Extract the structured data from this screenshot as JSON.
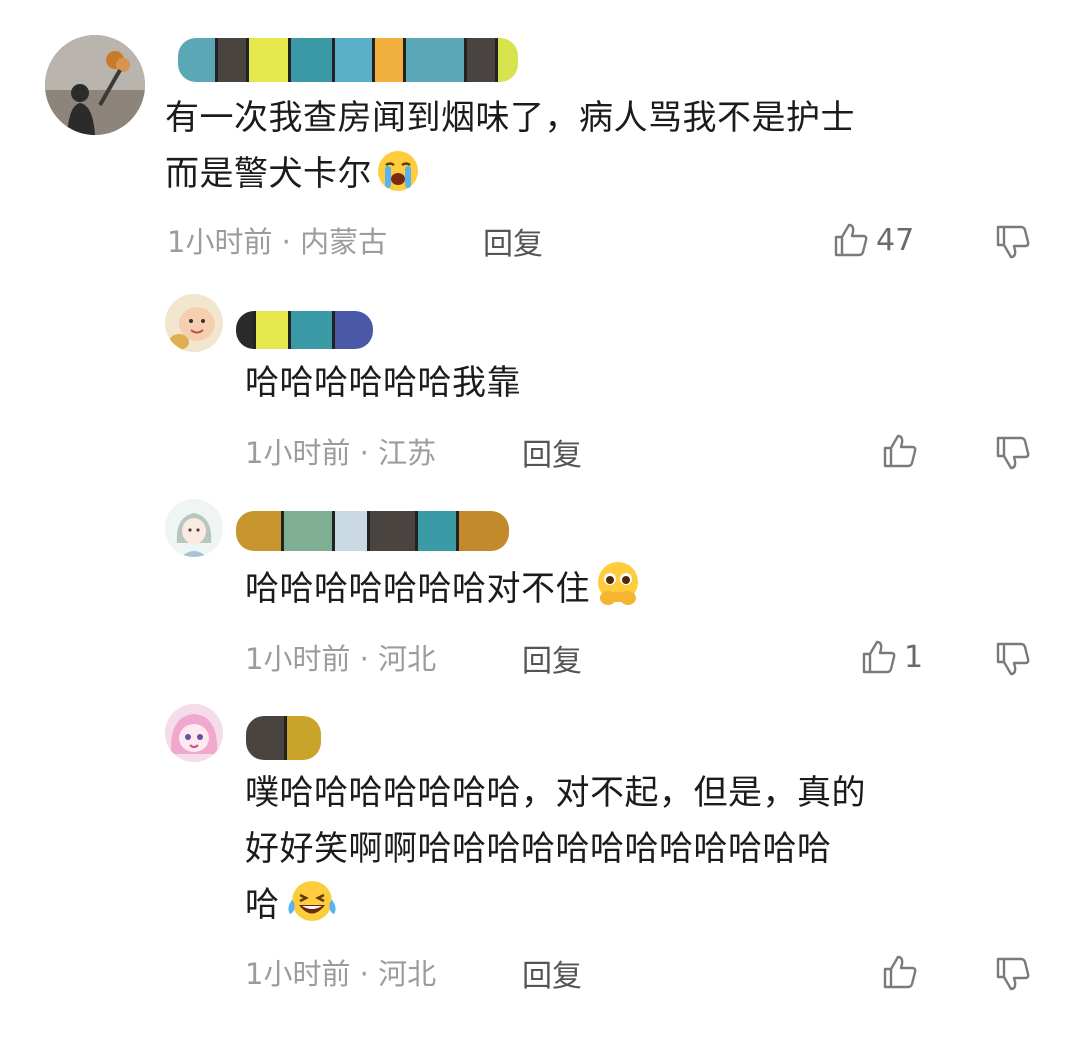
{
  "comments": [
    {
      "name_redacted": true,
      "text_lines": [
        "有一次我查房闻到烟味了，病人骂我不是护士",
        "而是警犬卡尔"
      ],
      "emoji": "loudly-crying-face-icon",
      "time": "1小时前",
      "separator": "·",
      "location": "内蒙古",
      "reply_label": "回复",
      "likes": "47"
    },
    {
      "name_redacted": true,
      "text_lines": [
        "哈哈哈哈哈哈我靠"
      ],
      "time": "1小时前",
      "separator": "·",
      "location": "江苏",
      "reply_label": "回复",
      "likes": ""
    },
    {
      "name_redacted": true,
      "text_lines": [
        "哈哈哈哈哈哈哈对不住"
      ],
      "emoji": "hand-over-mouth-pleading-face-icon",
      "time": "1小时前",
      "separator": "·",
      "location": "河北",
      "reply_label": "回复",
      "likes": "1"
    },
    {
      "name_redacted": true,
      "text_lines": [
        "噗哈哈哈哈哈哈哈，对不起，但是，真的",
        "好好笑啊啊哈哈哈哈哈哈哈哈哈哈哈哈",
        "哈"
      ],
      "emoji": "laughing-tears-face-icon",
      "time": "1小时前",
      "separator": "·",
      "location": "河北",
      "reply_label": "回复",
      "likes": ""
    }
  ],
  "colors": {
    "text": "#1b1b1b",
    "meta": "#9c9c9c",
    "reply": "#555555",
    "icon": "#7a7a7a"
  }
}
